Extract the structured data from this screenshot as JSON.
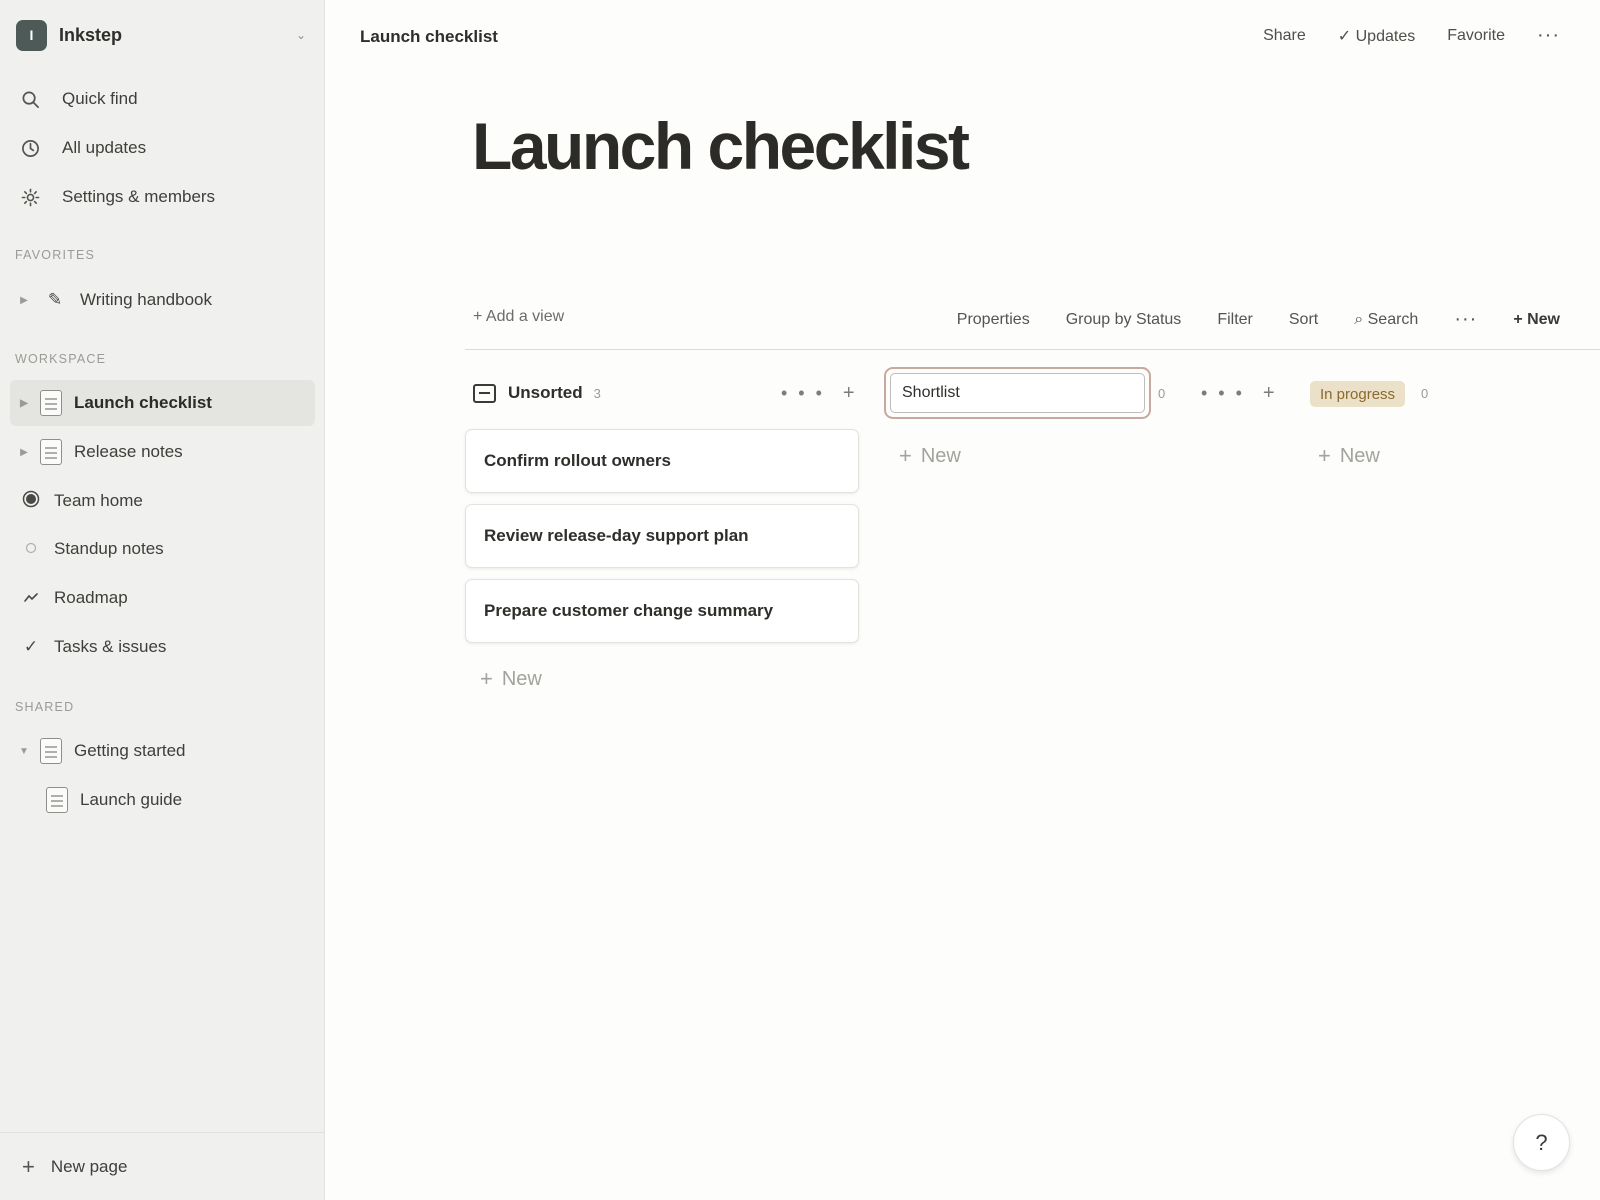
{
  "workspace": {
    "initial": "I",
    "name": "Inkstep",
    "chevron": "⌄"
  },
  "sidebar": {
    "nav": [
      {
        "label": "Quick find",
        "icon": "search-icon"
      },
      {
        "label": "All updates",
        "icon": "clock-icon"
      },
      {
        "label": "Settings & members",
        "icon": "gear-icon"
      }
    ],
    "favorites_label": "FAVORITES",
    "favorites": [
      {
        "label": "Writing handbook",
        "icon": "pencil-icon"
      }
    ],
    "workspace_label": "WORKSPACE",
    "workspace_items": [
      {
        "label": "Launch checklist",
        "icon": "page-icon",
        "active": true
      },
      {
        "label": "Release notes",
        "icon": "page-icon"
      },
      {
        "label": "Team home",
        "icon": "radio-icon"
      },
      {
        "label": "Standup notes",
        "icon": "circle-icon"
      },
      {
        "label": "Roadmap",
        "icon": "route-icon"
      },
      {
        "label": "Tasks & issues",
        "icon": "check-icon"
      }
    ],
    "shared_label": "SHARED",
    "shared": [
      {
        "label": "Getting started",
        "icon": "page-icon"
      },
      {
        "label": "Launch guide",
        "icon": "page-icon"
      }
    ],
    "new_page": "New page"
  },
  "topbar": {
    "breadcrumb": "Launch checklist",
    "share": "Share",
    "updates": "✓ Updates",
    "favorite": "Favorite",
    "more": "···"
  },
  "page": {
    "title": "Launch checklist"
  },
  "view_bar": {
    "add_view": "+ Add a view",
    "properties": "Properties",
    "group_by": "Group by Status",
    "filter": "Filter",
    "sort": "Sort",
    "search": "⌕ Search",
    "more": "···",
    "new": "+ New"
  },
  "board": {
    "columns": [
      {
        "title": "Unsorted",
        "count": "3",
        "cards": [
          "Confirm rollout owners",
          "Review release-day support plan",
          "Prepare customer change summary"
        ]
      },
      {
        "title": "Shortlist",
        "count": "0",
        "editing": true,
        "cards": []
      },
      {
        "title": "In progress",
        "count": "0",
        "cards": [],
        "color": "#ebe0c8"
      }
    ],
    "new_label": "New",
    "col_more": "• • •",
    "col_add": "+"
  },
  "help": "?"
}
